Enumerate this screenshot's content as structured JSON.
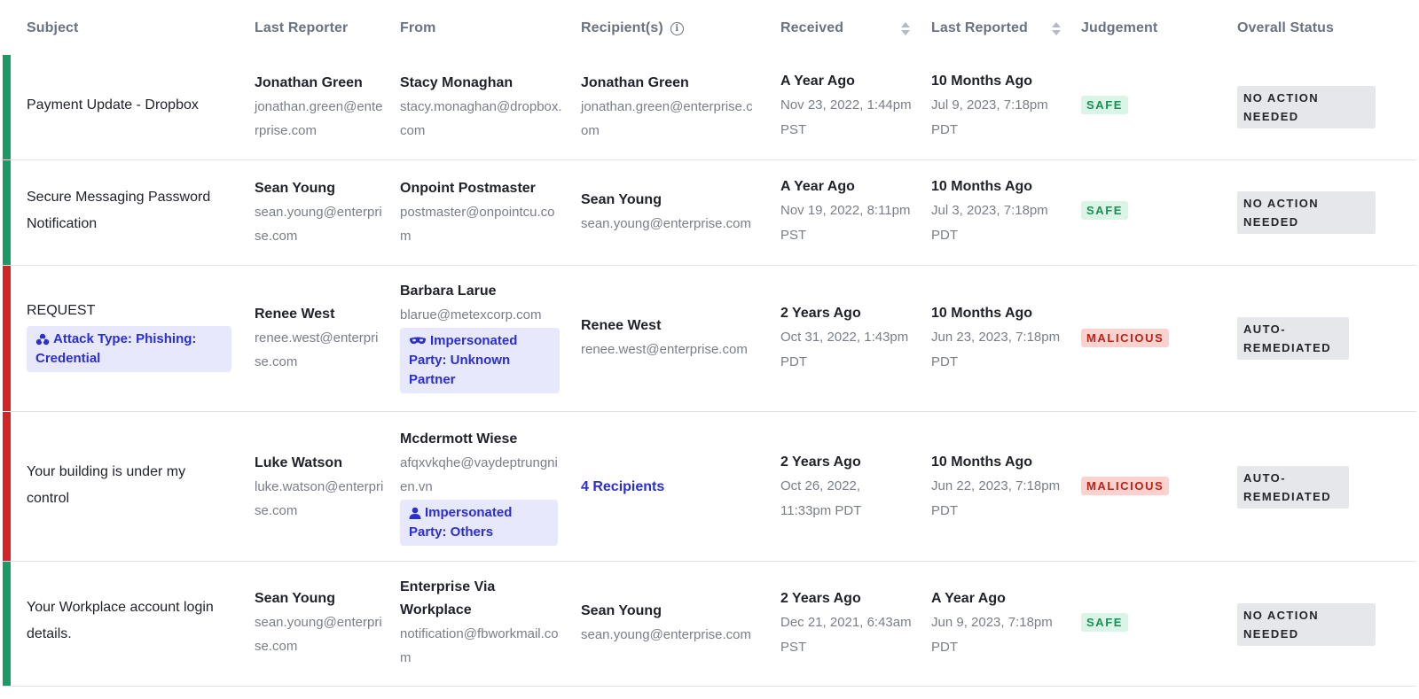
{
  "colors": {
    "safe_bar": "#1b9a66",
    "malicious_bar": "#d52323",
    "link": "#2b2fd1"
  },
  "header": {
    "subject": "Subject",
    "last_reporter": "Last Reporter",
    "from": "From",
    "recipients": "Recipient(s)",
    "received": "Received",
    "last_reported": "Last Reported",
    "judgement": "Judgement",
    "overall_status": "Overall Status"
  },
  "rows": [
    {
      "status_color": "safe",
      "subject": "Payment Update - Dropbox",
      "reporter_name": "Jonathan Green",
      "reporter_email": "jonathan.green@enterprise.com",
      "from_name": "Stacy Monaghan",
      "from_email": "stacy.monaghan@dropbox.com",
      "recipient_name": "Jonathan Green",
      "recipient_email": "jonathan.green@enterprise.com",
      "received_rel": "A Year Ago",
      "received_abs": "Nov 23, 2022, 1:44pm PST",
      "reported_rel": "10 Months Ago",
      "reported_abs": "Jul 9, 2023, 7:18pm PDT",
      "judgement": "SAFE",
      "overall_status": "NO ACTION NEEDED"
    },
    {
      "status_color": "safe",
      "subject": "Secure Messaging Password Notification",
      "reporter_name": "Sean Young",
      "reporter_email": "sean.young@enterprise.com",
      "from_name": "Onpoint Postmaster",
      "from_email": "postmaster@onpointcu.com",
      "recipient_name": "Sean Young",
      "recipient_email": "sean.young@enterprise.com",
      "received_rel": "A Year Ago",
      "received_abs": "Nov 19, 2022, 8:11pm PST",
      "reported_rel": "10 Months Ago",
      "reported_abs": "Jul 3, 2023, 7:18pm PDT",
      "judgement": "SAFE",
      "overall_status": "NO ACTION NEEDED"
    },
    {
      "status_color": "malicious",
      "subject": "REQUEST",
      "subject_tag": "Attack Type: Phishing: Credential",
      "subject_tag_icon": "biohazard-icon",
      "reporter_name": "Renee West",
      "reporter_email": "renee.west@enterprise.com",
      "from_name": "Barbara Larue",
      "from_email": "blarue@metexcorp.com",
      "from_tag": "Impersonated Party: Unknown Partner",
      "from_tag_icon": "mask-icon",
      "recipient_name": "Renee West",
      "recipient_email": "renee.west@enterprise.com",
      "received_rel": "2 Years Ago",
      "received_abs": "Oct 31, 2022, 1:43pm PDT",
      "reported_rel": "10 Months Ago",
      "reported_abs": "Jun 23, 2023, 7:18pm PDT",
      "judgement": "MALICIOUS",
      "overall_status": "AUTO-REMEDIATED"
    },
    {
      "status_color": "malicious",
      "subject": "Your building is under my control",
      "reporter_name": "Luke Watson",
      "reporter_email": "luke.watson@enterprise.com",
      "from_name": "Mcdermott Wiese",
      "from_email": "afqxvkqhe@vaydeptrungnien.vn",
      "from_tag": "Impersonated Party: Others",
      "from_tag_icon": "person-icon",
      "recipient_link": "4 Recipients",
      "received_rel": "2 Years Ago",
      "received_abs": "Oct 26, 2022, 11:33pm PDT",
      "reported_rel": "10 Months Ago",
      "reported_abs": "Jun 22, 2023, 7:18pm PDT",
      "judgement": "MALICIOUS",
      "overall_status": "AUTO-REMEDIATED"
    },
    {
      "status_color": "safe",
      "subject": "Your Workplace account login details.",
      "reporter_name": "Sean Young",
      "reporter_email": "sean.young@enterprise.com",
      "from_name": "Enterprise Via Workplace",
      "from_email": "notification@fbworkmail.com",
      "recipient_name": "Sean Young",
      "recipient_email": "sean.young@enterprise.com",
      "received_rel": "2 Years Ago",
      "received_abs": "Dec 21, 2021, 6:43am PST",
      "reported_rel": "A Year Ago",
      "reported_abs": "Jun 9, 2023, 7:18pm PDT",
      "judgement": "SAFE",
      "overall_status": "NO ACTION NEEDED"
    }
  ]
}
